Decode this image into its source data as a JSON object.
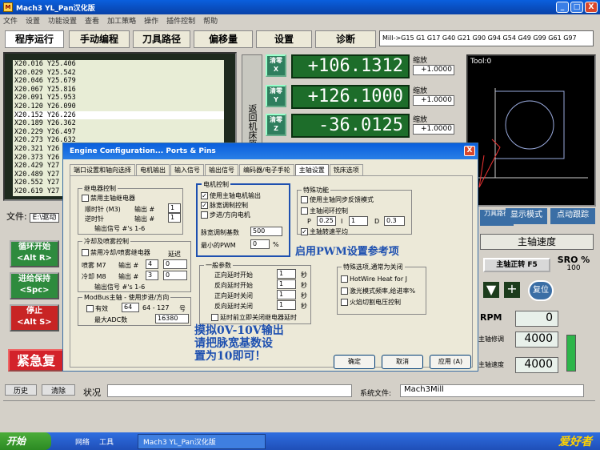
{
  "window": {
    "title": "Mach3  YL_Pan汉化版",
    "buttons": [
      "_",
      "□",
      "X"
    ]
  },
  "menu": [
    "文件",
    "设置",
    "功能设置",
    "查看",
    "加工策略",
    "操作",
    "插件控制",
    "帮助"
  ],
  "tabs": [
    "程序运行",
    "手动编程",
    "刀具路径",
    "偏移量",
    "设置",
    "诊断"
  ],
  "mdi": "Mill->G15  G1 G17 G40 G21 G90 G94 G54 G49 G99 G61 G97",
  "gcode_lines": [
    "X20.016 Y25.406",
    "X20.029 Y25.542",
    "X20.046 Y25.679",
    "X20.067 Y25.816",
    "X20.091 Y25.953",
    "X20.120 Y26.090",
    "X20.152 Y26.226",
    "X20.189 Y26.362",
    "X20.229 Y26.497",
    "X20.273 Y26.632",
    "X20.321 Y26",
    "X20.373 Y26",
    "X20.429 Y27",
    "X20.489 Y27",
    "X20.552 Y27",
    "X20.619 Y27"
  ],
  "ref_home": "返回机床原点",
  "zero_buttons": [
    {
      "label": "清零",
      "axis": "X"
    },
    {
      "label": "清零",
      "axis": "Y"
    },
    {
      "label": "清零",
      "axis": "Z"
    }
  ],
  "dro": [
    "+106.1312",
    "+126.1000",
    "-36.0125"
  ],
  "scale": {
    "label": "缩放",
    "values": [
      "+1.0000",
      "+1.0000",
      "+1.0000"
    ]
  },
  "toolpath_label": "Tool:0",
  "dialog": {
    "title": "Engine Configuration... Ports & Pins",
    "close": "X",
    "tabs": [
      "端口设置和轴向选择",
      "电机输出",
      "输入信号",
      "输出信号",
      "编码器/电子手轮",
      "主轴设置",
      "铣床选项"
    ],
    "relay": {
      "title": "继电器控制",
      "disable": "禁用主轴继电器",
      "cw": "顺时针 (M3)",
      "ccw": "逆时针",
      "output": "输出 #",
      "cw_val": "1",
      "ccw_val": "1",
      "signals": "输出信号 #'s 1-6"
    },
    "coolant": {
      "title": "冷却及喷雾控制",
      "disable": "禁用冷却/喷雾继电器",
      "delay": "延迟",
      "mist": "喷雾 M7",
      "flood": "冷却 M8",
      "output": "输出 #",
      "mist_val": "4",
      "flood_val": "3",
      "mist_delay": "0",
      "flood_delay": "0",
      "signals": "输出信号 #'s 1-6"
    },
    "modbus": {
      "title": "ModBus主轴 - 使用步进/方向",
      "enabled": "有效",
      "reg": "64",
      "range": "64 - 127",
      "unit": "号",
      "max_adc": "最大ADC数",
      "max_adc_val": "16380"
    },
    "motor": {
      "title": "电机控制",
      "use_motor": "使用主轴电机输出",
      "pwm": "脉宽调制控制",
      "stepdir": "步进/方向电机",
      "pwm_base": "脉宽调制基数",
      "pwm_base_val": "500",
      "min_pwm": "最小的PWM",
      "min_pwm_val": "0",
      "pct": "%"
    },
    "special": {
      "title": "特殊功能",
      "sync": "使用主轴同步反馈模式",
      "closed": "主轴闭环控制",
      "p": "P",
      "p_val": "0.25",
      "i": "I",
      "i_val": "1",
      "d": "D",
      "d_val": "0.3",
      "avg": "主轴转速平均"
    },
    "general": {
      "title": "一般参数",
      "rows": [
        "正向延时开始",
        "反向延时开始",
        "正向延时关闭",
        "反向延时关闭"
      ],
      "vals": [
        "1",
        "1",
        "1",
        "1"
      ],
      "unit": "秒",
      "relay_delay": "延时前立即关闭继电器延时"
    },
    "options": {
      "title": "特殊选项,通常为关闭",
      "items": [
        "HotWire Heat for J",
        "激光模式频率,给进率%",
        "火焰切割电压控制"
      ]
    },
    "buttons": [
      "确定",
      "取消",
      "应用 (A)"
    ],
    "note1": "启用PWM设置参考项",
    "note2": "摸拟0V-10V输出\n请把脉宽基数设\n置为10即可！"
  },
  "left_buttons": [
    {
      "label": "循环开始",
      "key": "<Alt R>",
      "color": "#2e8b3e"
    },
    {
      "label": "进给保持",
      "key": "<Spc>",
      "color": "#2e8b3e"
    },
    {
      "label": "停止",
      "key": "<Alt S>",
      "color": "#c82424"
    }
  ],
  "estop": "紧急复",
  "file_label": "文件:",
  "file_value": "E:\\驱动",
  "right": {
    "tool_btn": "刀具路径",
    "show_mode": "显示模式",
    "jog": "点动跟踪",
    "spindle_speed_title": "主轴速度",
    "spindle_stop": "主轴正转 F5",
    "sro_label": "SRO %",
    "sro_val": "100",
    "rpm_label": "RPM",
    "rpm_val": "0",
    "override_label": "主轴修调",
    "override_val": "4000",
    "speed_label": "主轴速度",
    "speed_val": "4000",
    "reset": "复位"
  },
  "status": {
    "history": "历史",
    "clear": "清除",
    "state_label": "状况",
    "profile_label": "系统文件:",
    "profile_val": "Mach3Mill"
  },
  "taskbar": {
    "start": "开始",
    "net": "网络",
    "tools": "工具",
    "task": "Mach3 YL_Pan汉化版"
  },
  "logo": "爱好者"
}
